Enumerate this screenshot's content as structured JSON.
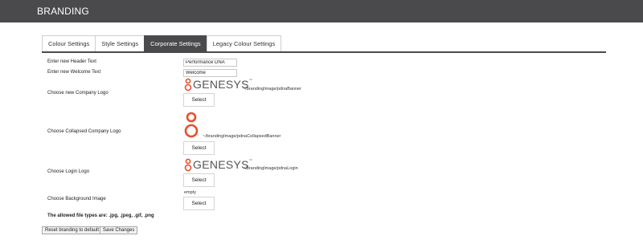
{
  "header": {
    "title": "BRANDING"
  },
  "tabs": [
    {
      "label": "Colour Settings"
    },
    {
      "label": "Style Settings"
    },
    {
      "label": "Corporate Settings"
    },
    {
      "label": "Legacy Colour Settings"
    }
  ],
  "active_tab": "Corporate Settings",
  "form": {
    "header_text": {
      "label": "Enter new Header Text",
      "value": "Performance DNA"
    },
    "welcome_text": {
      "label": "Enter new Welcome Text",
      "value": "Welcome"
    },
    "company_logo": {
      "label": "Choose new Company Logo",
      "logo_text": "GENESYS",
      "trademark": "™",
      "path": "~/brandingImage/pdnaBanner",
      "button_label": "Select"
    },
    "collapsed_logo": {
      "label": "Choose Collapsed Company Logo",
      "path": "~/brandingImage/pdnaCollapsedBanner",
      "button_label": "Select"
    },
    "login_logo": {
      "label": "Choose Login Logo",
      "logo_text": "GENESYS",
      "trademark": "™",
      "path": "~/brandingImage/pdnaLogin",
      "button_label": "Select"
    },
    "background_image": {
      "label": "Choose Background Image",
      "value": "empty",
      "button_label": "Select"
    },
    "allowed_types": "The allowed file types are: .jpg, .jpeg, .gif, .png"
  },
  "actions": {
    "reset_label": "Reset branding to default",
    "save_label": "Save Changes"
  },
  "colors": {
    "header_bg": "#4a4a4d",
    "brand_orange": "#e8502c",
    "logo_text": "#555555"
  },
  "icons": {
    "logo_mark": "genesys-logo-icon",
    "collapsed_mark": "genesys-g-icon"
  }
}
